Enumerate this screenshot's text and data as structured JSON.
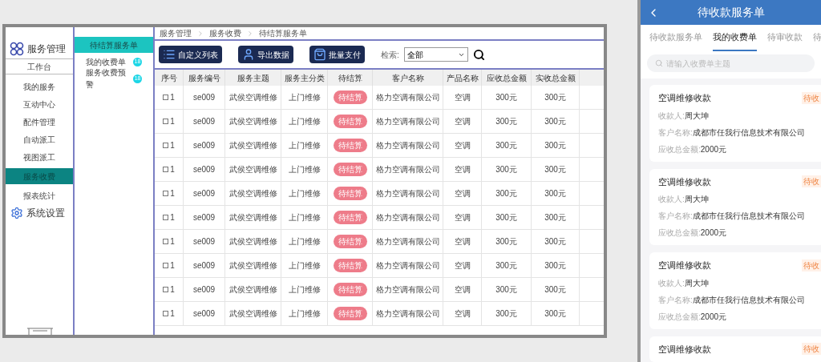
{
  "sidebar": {
    "title": "服务管理",
    "items": [
      {
        "label": "工作台",
        "kind": "boxed",
        "selected": false
      },
      {
        "label": "我的服务",
        "kind": "item",
        "selected": false
      },
      {
        "label": "互动中心",
        "kind": "item",
        "selected": false
      },
      {
        "label": "配件管理",
        "kind": "item",
        "selected": false
      },
      {
        "label": "自动派工",
        "kind": "item",
        "selected": false
      },
      {
        "label": "视图派工",
        "kind": "item",
        "selected": false
      },
      {
        "label": "服务收费",
        "kind": "item",
        "selected": true
      },
      {
        "label": "报表统计",
        "kind": "item",
        "selected": false
      }
    ],
    "settings": "系统设置"
  },
  "subnav": {
    "header": "待结算服务单",
    "items": [
      {
        "label": "我的收费单",
        "count": "18"
      },
      {
        "label": "服务收费预警",
        "count": "18"
      }
    ]
  },
  "breadcrumb": [
    "服务管理",
    "服务收费",
    "待结算服务单"
  ],
  "toolbar": {
    "buttons": [
      {
        "label": "自定义列表",
        "kind": "list"
      },
      {
        "label": "导出数据",
        "kind": "user"
      },
      {
        "label": "批量支付",
        "kind": "bag"
      }
    ],
    "search_label": "检索:",
    "filter_value": "全部"
  },
  "table": {
    "columns": [
      "序号",
      "服务编号",
      "服务主题",
      "服务主分类",
      "待结算",
      "客户名称",
      "产品名称",
      "应收总金额",
      "实收总金额"
    ],
    "rows": [
      {
        "checked": false,
        "index": "1",
        "code": "se009",
        "subject": "武侯空调维修",
        "category": "上门维修",
        "status": "待结算",
        "customer": "格力空调有限公司",
        "product": "空调",
        "due": "300元",
        "paid": "300元"
      },
      {
        "checked": false,
        "index": "1",
        "code": "se009",
        "subject": "武侯空调维修",
        "category": "上门维修",
        "status": "待结算",
        "customer": "格力空调有限公司",
        "product": "空调",
        "due": "300元",
        "paid": "300元"
      },
      {
        "checked": false,
        "index": "1",
        "code": "se009",
        "subject": "武侯空调维修",
        "category": "上门维修",
        "status": "待结算",
        "customer": "格力空调有限公司",
        "product": "空调",
        "due": "300元",
        "paid": "300元"
      },
      {
        "checked": false,
        "index": "1",
        "code": "se009",
        "subject": "武侯空调维修",
        "category": "上门维修",
        "status": "待结算",
        "customer": "格力空调有限公司",
        "product": "空调",
        "due": "300元",
        "paid": "300元"
      },
      {
        "checked": false,
        "index": "1",
        "code": "se009",
        "subject": "武侯空调维修",
        "category": "上门维修",
        "status": "待结算",
        "customer": "格力空调有限公司",
        "product": "空调",
        "due": "300元",
        "paid": "300元"
      },
      {
        "checked": false,
        "index": "1",
        "code": "se009",
        "subject": "武侯空调维修",
        "category": "上门维修",
        "status": "待结算",
        "customer": "格力空调有限公司",
        "product": "空调",
        "due": "300元",
        "paid": "300元"
      },
      {
        "checked": false,
        "index": "1",
        "code": "se009",
        "subject": "武侯空调维修",
        "category": "上门维修",
        "status": "待结算",
        "customer": "格力空调有限公司",
        "product": "空调",
        "due": "300元",
        "paid": "300元"
      },
      {
        "checked": false,
        "index": "1",
        "code": "se009",
        "subject": "武侯空调维修",
        "category": "上门维修",
        "status": "待结算",
        "customer": "格力空调有限公司",
        "product": "空调",
        "due": "300元",
        "paid": "300元"
      },
      {
        "checked": false,
        "index": "1",
        "code": "se009",
        "subject": "武侯空调维修",
        "category": "上门维修",
        "status": "待结算",
        "customer": "格力空调有限公司",
        "product": "空调",
        "due": "300元",
        "paid": "300元"
      },
      {
        "checked": false,
        "index": "1",
        "code": "se009",
        "subject": "武侯空调维修",
        "category": "上门维修",
        "status": "待结算",
        "customer": "格力空调有限公司",
        "product": "空调",
        "due": "300元",
        "paid": "300元"
      }
    ]
  },
  "mobile": {
    "title": "待收款服务单",
    "tabs": [
      {
        "label": "待收款服务单",
        "selected": false
      },
      {
        "label": "我的收费单",
        "selected": true
      },
      {
        "label": "待审收款",
        "selected": false
      },
      {
        "label": "待",
        "selected": false
      }
    ],
    "search_placeholder": "请输入收费单主题",
    "cards": [
      {
        "title": "空调维修收款",
        "badge": "待收",
        "fields": [
          {
            "label": "收款人:",
            "value": "周大坤"
          },
          {
            "label": "客户名称:",
            "value": "成都市任我行信息技术有限公司"
          },
          {
            "label": "应收总金额:",
            "value": "2000元"
          }
        ]
      },
      {
        "title": "空调维修收款",
        "badge": "待收",
        "fields": [
          {
            "label": "收款人:",
            "value": "周大坤"
          },
          {
            "label": "客户名称:",
            "value": "成都市任我行信息技术有限公司"
          },
          {
            "label": "应收总金额:",
            "value": "2000元"
          }
        ]
      },
      {
        "title": "空调维修收款",
        "badge": "待收",
        "fields": [
          {
            "label": "收款人:",
            "value": "周大坤"
          },
          {
            "label": "客户名称:",
            "value": "成都市任我行信息技术有限公司"
          },
          {
            "label": "应收总金额:",
            "value": "2000元"
          }
        ]
      },
      {
        "title": "空调维修收款",
        "badge": "待收"
      }
    ]
  }
}
